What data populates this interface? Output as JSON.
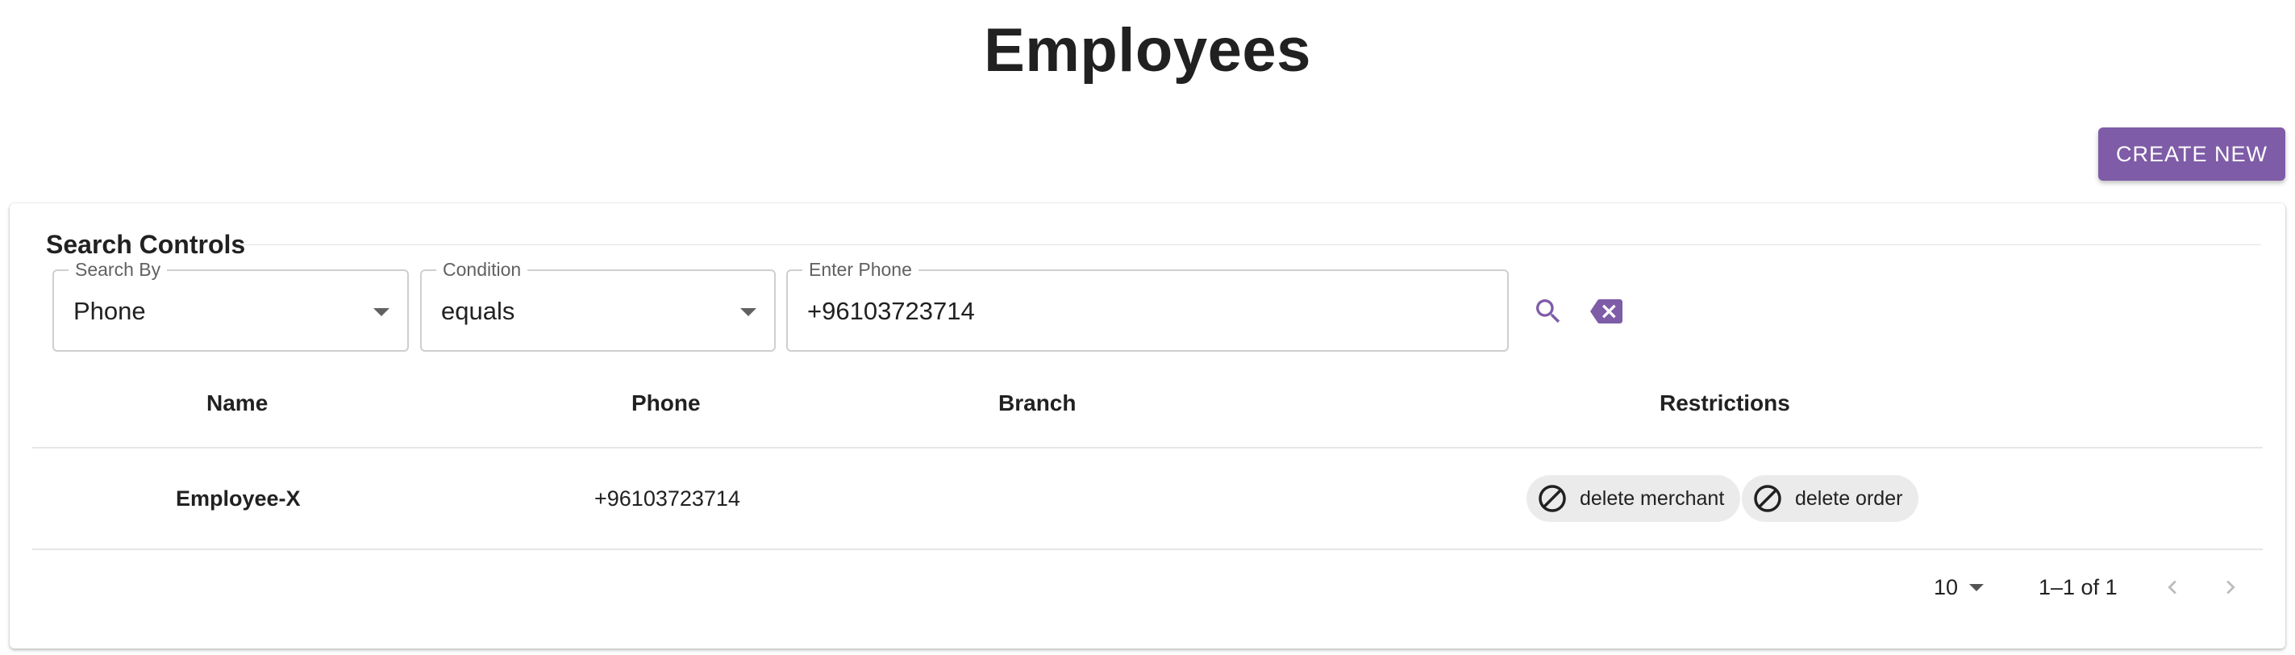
{
  "page": {
    "title": "Employees",
    "create_button": "CREATE NEW"
  },
  "search": {
    "legend": "Search Controls",
    "search_by": {
      "label": "Search By",
      "value": "Phone"
    },
    "condition": {
      "label": "Condition",
      "value": "equals"
    },
    "phone": {
      "label": "Enter Phone",
      "value": "+96103723714"
    },
    "search_icon": "search-icon",
    "clear_icon": "backspace-clear-icon"
  },
  "table": {
    "columns": [
      "Name",
      "Phone",
      "Branch",
      "Restrictions"
    ],
    "rows": [
      {
        "name": "Employee-X",
        "phone": "+96103723714",
        "branch": "",
        "restrictions": [
          "delete merchant",
          "delete order"
        ]
      }
    ]
  },
  "pagination": {
    "rows_per_page": "10",
    "range": "1–1 of 1"
  },
  "colors": {
    "accent": "#7e5ca7",
    "chip_bg": "#ebebeb",
    "border": "#cfcfcf"
  }
}
